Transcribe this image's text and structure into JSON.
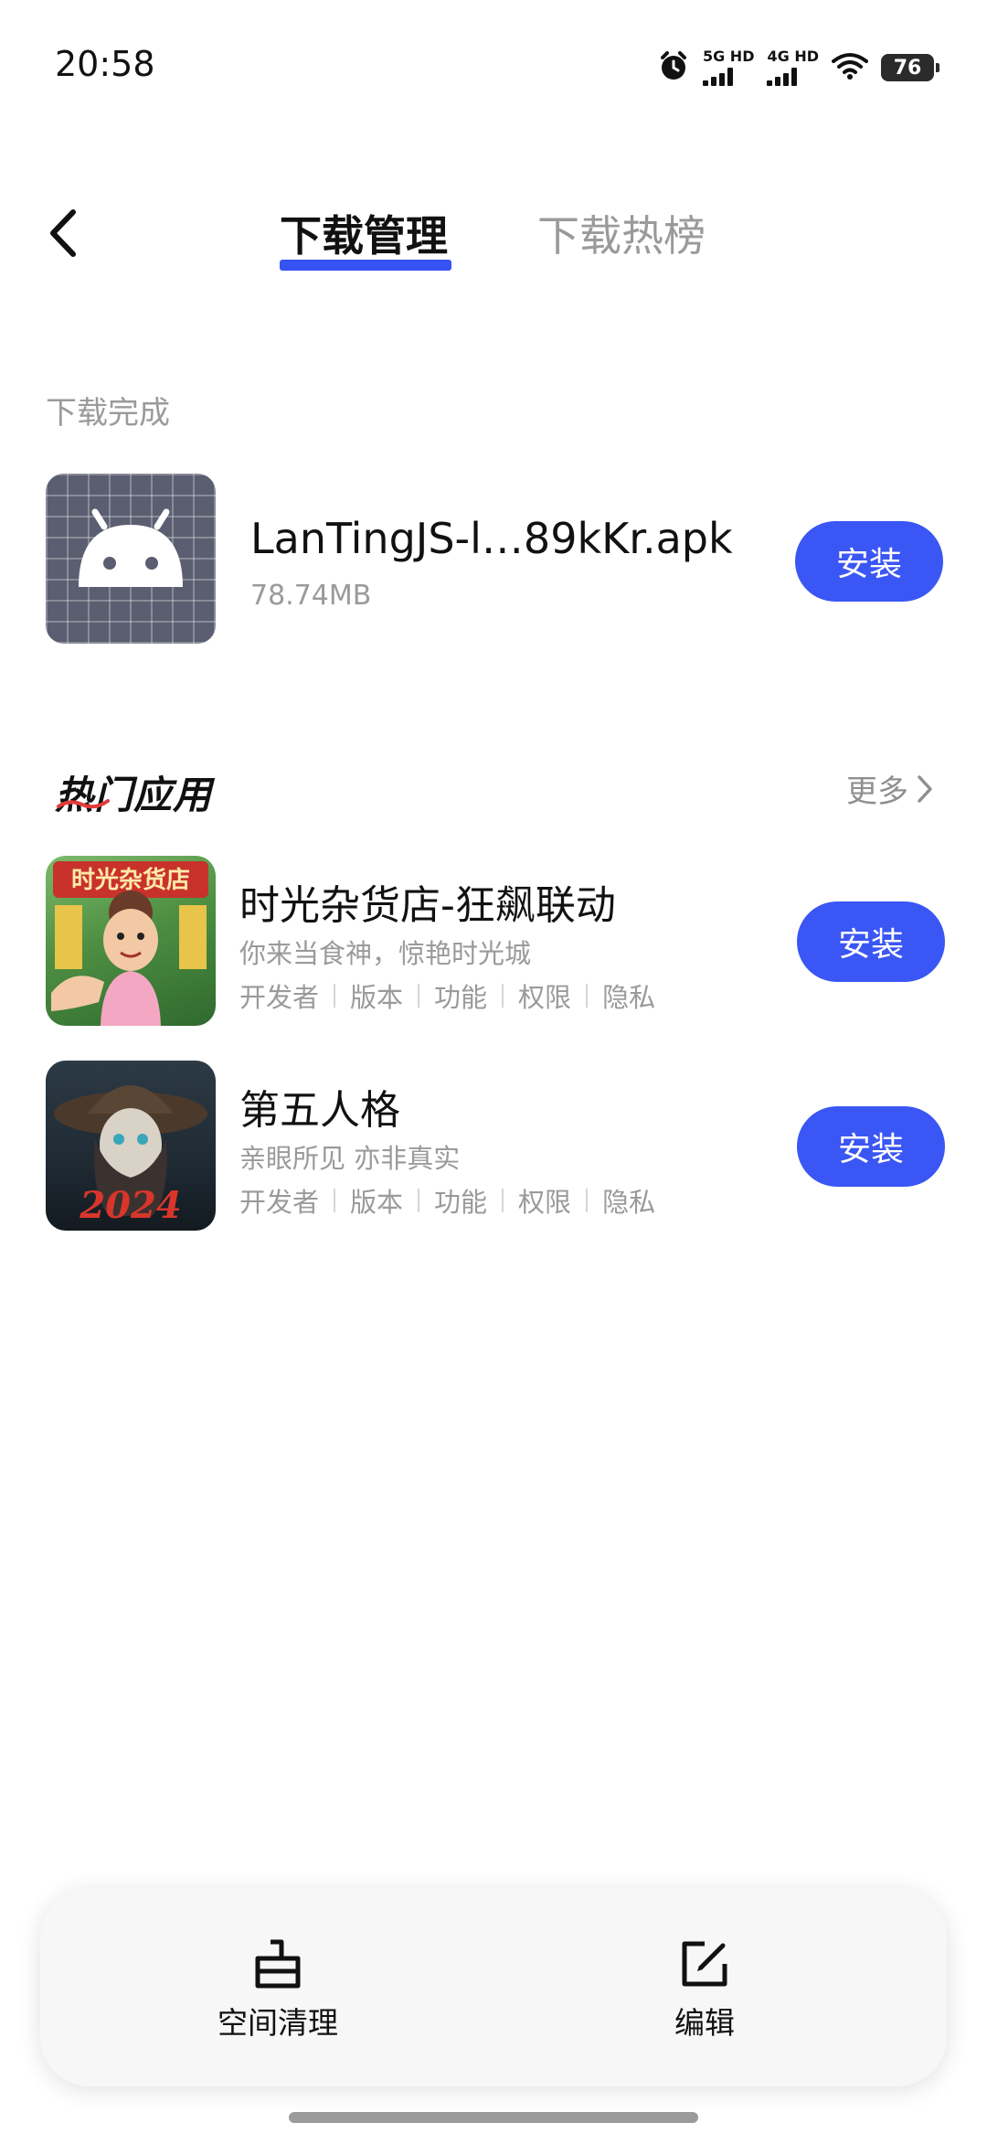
{
  "status_bar": {
    "time": "20:58",
    "sim1_label": "5G HD",
    "sim2_label": "4G HD",
    "battery": "76"
  },
  "header": {
    "tab_download_manage": "下载管理",
    "tab_download_hot": "下载热榜",
    "accent_color": "#3552f2"
  },
  "downloaded": {
    "section_label": "下载完成",
    "items": [
      {
        "name": "LanTingJS-l…89kKr.apk",
        "size": "78.74MB",
        "install_label": "安装"
      }
    ]
  },
  "hot_apps": {
    "title": "热门应用",
    "more_label": "更多",
    "apps": [
      {
        "name": "时光杂货店-狂飙联动",
        "desc": "你来当食神，惊艳时光城",
        "icon_text": "时光杂货店",
        "meta": [
          "开发者",
          "版本",
          "功能",
          "权限",
          "隐私"
        ],
        "install_label": "安装"
      },
      {
        "name": "第五人格",
        "desc": "亲眼所见 亦非真实",
        "icon_text": "2024",
        "meta": [
          "开发者",
          "版本",
          "功能",
          "权限",
          "隐私"
        ],
        "install_label": "安装"
      }
    ]
  },
  "toolbar": {
    "clean_label": "空间清理",
    "edit_label": "编辑"
  }
}
